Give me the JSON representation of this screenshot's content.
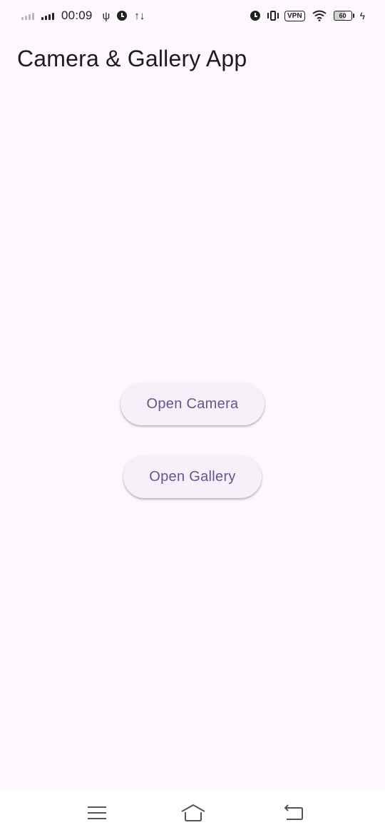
{
  "status_bar": {
    "time": "00:09",
    "usb_icon": "usb-icon",
    "alarm_icon": "alarm-icon",
    "data_icon": "data-transfer-icon",
    "vpn_label": "VPN",
    "battery_level": "60"
  },
  "app_bar": {
    "title": "Camera & Gallery App"
  },
  "actions": {
    "open_camera_label": "Open Camera",
    "open_gallery_label": "Open Gallery"
  },
  "nav_bar": {
    "menu_icon": "menu-icon",
    "home_icon": "home-icon",
    "back_icon": "back-icon"
  },
  "colors": {
    "background": "#fdf7fe",
    "button_background": "#f6f1f8",
    "button_text": "#65558f",
    "title_text": "#1d1b20"
  }
}
